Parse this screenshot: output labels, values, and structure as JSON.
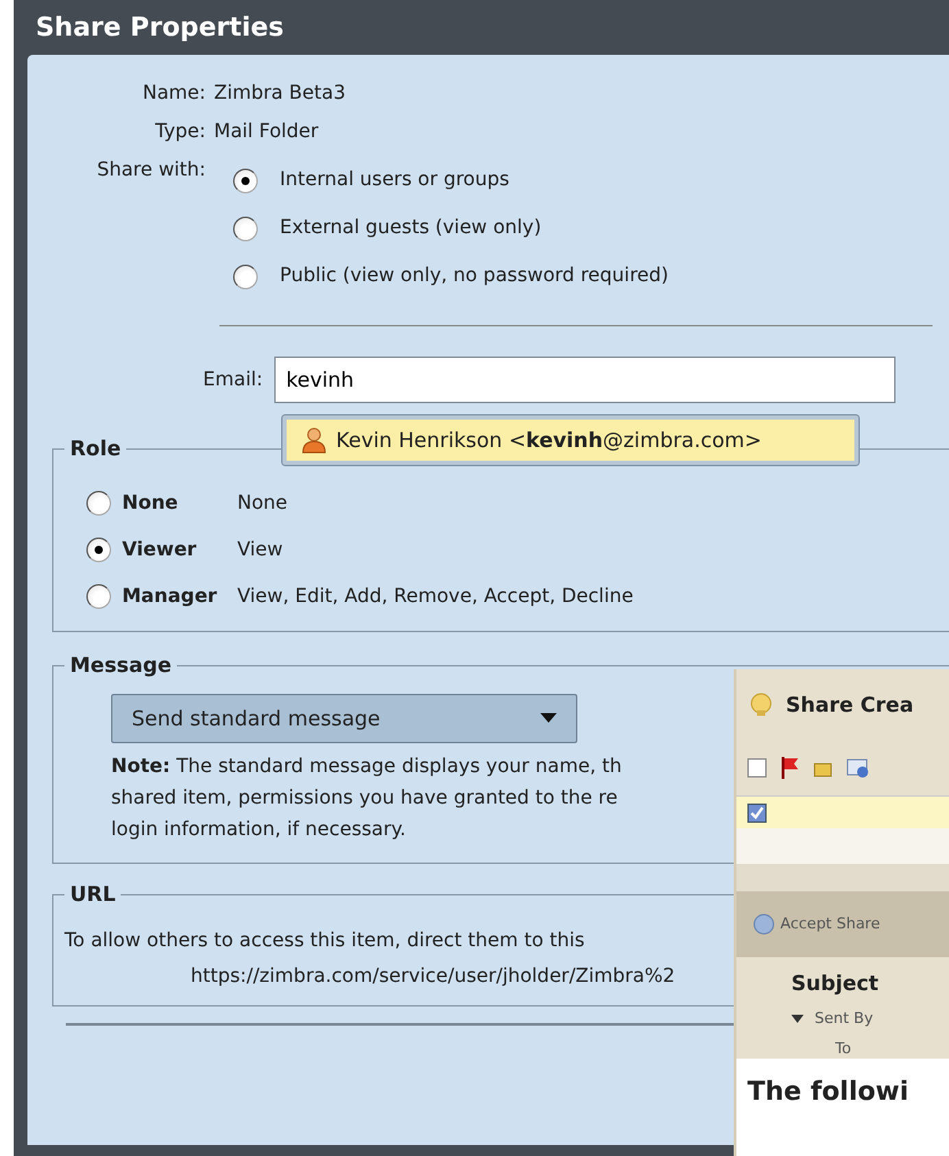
{
  "dialog": {
    "title": "Share Properties"
  },
  "properties": [
    {
      "label": "Name:",
      "value": "Zimbra Beta3"
    },
    {
      "label": "Type:",
      "value": "Mail Folder"
    }
  ],
  "share_with": {
    "label": "Share with:",
    "options": [
      {
        "label": "Internal users or groups",
        "selected": true
      },
      {
        "label": "External guests (view only)",
        "selected": false
      },
      {
        "label": "Public (view only, no password required)",
        "selected": false
      }
    ]
  },
  "email": {
    "label": "Email:",
    "value": "kevinh"
  },
  "suggestion": {
    "text": "Kevin Henrikson <**kevinh**@zimbra.com>"
  },
  "role": {
    "legend": "Role",
    "options": [
      {
        "name": "None",
        "description": "None",
        "selected": false
      },
      {
        "name": "Viewer",
        "description": "View",
        "selected": true
      },
      {
        "name": "Manager",
        "description": "View, Edit, Add, Remove, Accept, Decline",
        "selected": false
      }
    ]
  },
  "message": {
    "legend": "Message",
    "dropdown": "Send standard message",
    "note_lines": [
      "**Note:** The standard message displays your name, th",
      "shared item, permissions you have granted to the re",
      "login information, if necessary."
    ]
  },
  "url": {
    "legend": "URL",
    "text": "To allow others to access this item, direct them to this",
    "link": "https://zimbra.com/service/user/jholder/Zimbra%2"
  },
  "overlay_window": {
    "title": "Share Crea",
    "action": "Accept Share",
    "subject": "Subject",
    "sent_by": "Sent By",
    "to": "To",
    "body": "The followi"
  }
}
